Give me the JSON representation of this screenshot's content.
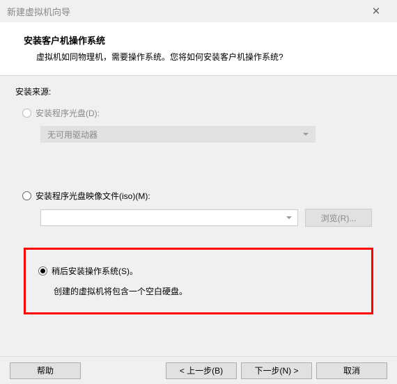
{
  "titlebar": {
    "title": "新建虚拟机向导"
  },
  "header": {
    "title": "安装客户机操作系统",
    "subtitle": "虚拟机如同物理机，需要操作系统。您将如何安装客户机操作系统?"
  },
  "body": {
    "source_label": "安装来源:",
    "option_disc": {
      "label": "安装程序光盘(D):",
      "dropdown_selected": "无可用驱动器"
    },
    "option_iso": {
      "label": "安装程序光盘映像文件(iso)(M):",
      "browse": "浏览(R)..."
    },
    "option_later": {
      "label": "稍后安装操作系统(S)。",
      "description": "创建的虚拟机将包含一个空白硬盘。"
    }
  },
  "footer": {
    "help": "帮助",
    "back": "< 上一步(B)",
    "next": "下一步(N) >",
    "cancel": "取消"
  }
}
